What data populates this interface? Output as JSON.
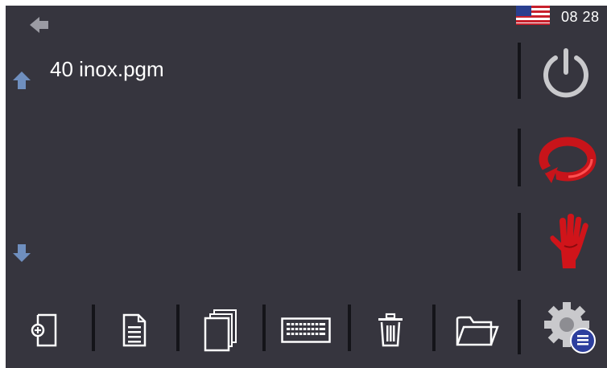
{
  "status": {
    "time": "08 28",
    "flag": "us-flag-icon"
  },
  "file_list": {
    "items": [
      {
        "name": "40 inox.pgm"
      }
    ],
    "scroll_up": "arrow-up-icon",
    "scroll_down": "arrow-down-icon"
  },
  "nav": {
    "back": "arrow-left-icon"
  },
  "side_actions": [
    {
      "name": "power-icon",
      "color": "#c8c8c8"
    },
    {
      "name": "reset-icon",
      "color": "#d01010"
    },
    {
      "name": "stop-hand-icon",
      "color": "#d01010"
    },
    {
      "name": "settings-icon",
      "color": "#c8c8c8"
    }
  ],
  "bottom_actions": [
    {
      "name": "new-file-icon"
    },
    {
      "name": "open-document-icon"
    },
    {
      "name": "copy-icon"
    },
    {
      "name": "keyboard-icon"
    },
    {
      "name": "trash-icon"
    },
    {
      "name": "folder-icon"
    }
  ],
  "colors": {
    "background": "#36353e",
    "separator": "#141419",
    "arrow": "#6f8fbf",
    "accent_red": "#d01010"
  }
}
